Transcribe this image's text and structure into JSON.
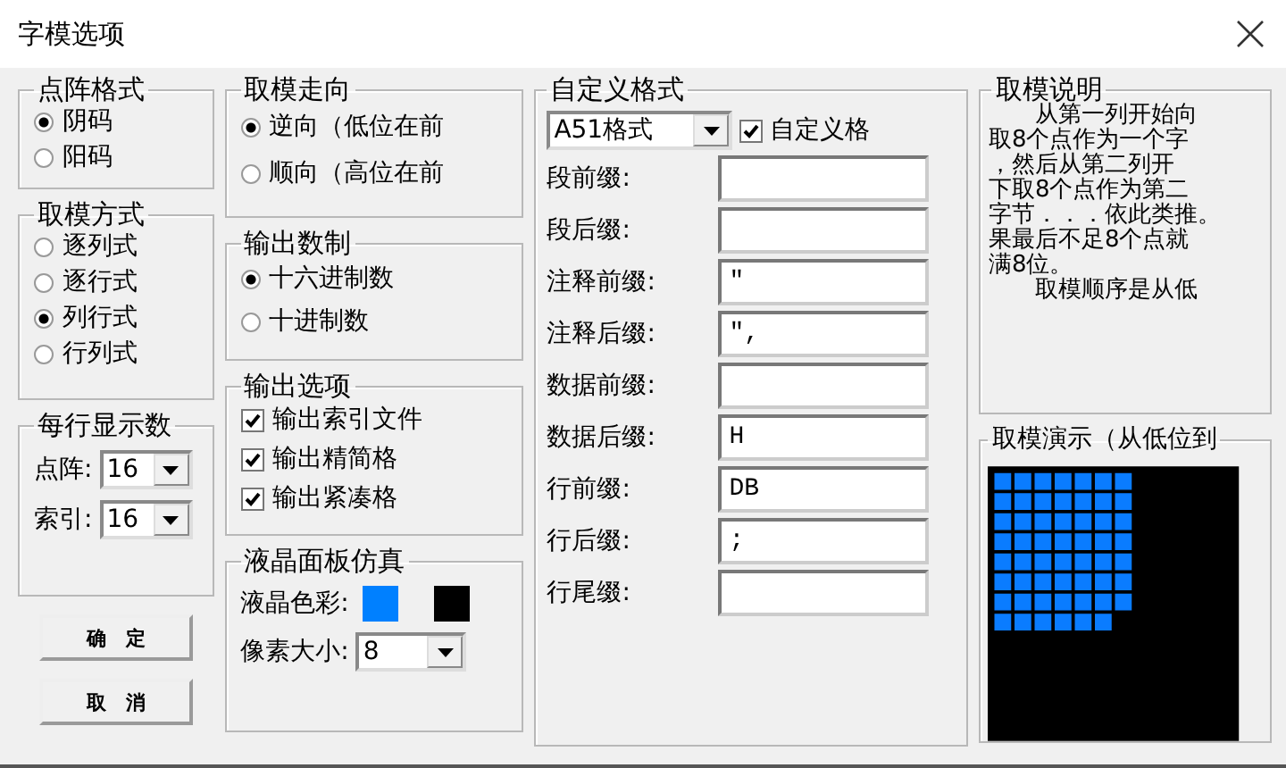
{
  "window": {
    "title": "字模选项"
  },
  "dot_format": {
    "title": "点阵格式",
    "options": [
      {
        "label": "阴码",
        "selected": true
      },
      {
        "label": "阳码",
        "selected": false
      }
    ]
  },
  "scan_mode": {
    "title": "取模方式",
    "options": [
      {
        "label": "逐列式",
        "selected": false
      },
      {
        "label": "逐行式",
        "selected": false
      },
      {
        "label": "列行式",
        "selected": true
      },
      {
        "label": "行列式",
        "selected": false
      }
    ]
  },
  "per_line": {
    "title": "每行显示数",
    "fields": [
      {
        "label": "点阵:",
        "value": "16"
      },
      {
        "label": "索引:",
        "value": "16"
      }
    ]
  },
  "buttons": [
    "确　定",
    "取　消"
  ],
  "direction": {
    "title": "取模走向",
    "options": [
      {
        "label": "逆向（低位在前",
        "selected": true
      },
      {
        "label": "顺向（高位在前",
        "selected": false
      }
    ]
  },
  "number_base": {
    "title": "输出数制",
    "options": [
      {
        "label": "十六进制数",
        "selected": true
      },
      {
        "label": "十进制数",
        "selected": false
      }
    ]
  },
  "output_options": {
    "title": "输出选项",
    "items": [
      {
        "label": "输出索引文件",
        "checked": true
      },
      {
        "label": "输出精简格",
        "checked": true
      },
      {
        "label": "输出紧凑格",
        "checked": true
      }
    ]
  },
  "lcd": {
    "title": "液晶面板仿真",
    "color_label": "液晶色彩:",
    "colors": [
      {
        "color": "#0080ff"
      },
      {
        "color": "#000000"
      }
    ],
    "pixel_label": "像素大小:",
    "pixel_value": "8"
  },
  "custom": {
    "title": "自定义格式",
    "preset": "A51格式",
    "enable": {
      "label": "自定义格",
      "checked": true
    },
    "fields": [
      {
        "label": "段前缀:"
      },
      {
        "label": "段后缀:"
      },
      {
        "label": "注释前缀:",
        "value": "\""
      },
      {
        "label": "注释后缀:",
        "value": "\","
      },
      {
        "label": "数据前缀:"
      },
      {
        "label": "数据后缀:",
        "value": "H"
      },
      {
        "label": "行前缀:",
        "value": "DB"
      },
      {
        "label": "行后缀:",
        "value": ";"
      },
      {
        "label": "行尾缀:"
      }
    ]
  },
  "description": {
    "title": "取模说明",
    "lines": [
      "　　从第一列开始向",
      "取8个点作为一个字",
      "，然后从第二列开",
      "下取8个点作为第二",
      "字节．．．依此类推。",
      "果最后不足8个点就",
      "满8位。",
      "　　取模顺序是从低"
    ]
  },
  "demo": {
    "title": "取模演示（从低位到"
  }
}
